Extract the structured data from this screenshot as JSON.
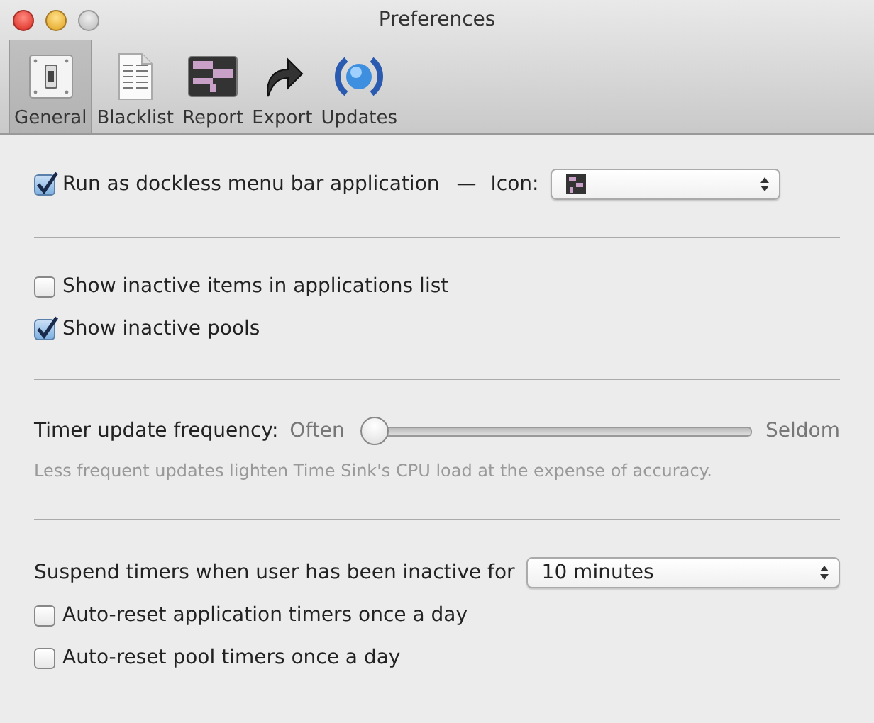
{
  "window": {
    "title": "Preferences"
  },
  "toolbar": [
    {
      "label": "General",
      "kind": "switch",
      "selected": true
    },
    {
      "label": "Blacklist",
      "kind": "document",
      "selected": false
    },
    {
      "label": "Report",
      "kind": "grid",
      "selected": false
    },
    {
      "label": "Export",
      "kind": "arrow",
      "selected": false
    },
    {
      "label": "Updates",
      "kind": "globe",
      "selected": false
    }
  ],
  "dock": {
    "label": "Run as dockless menu bar application",
    "checked": true,
    "separator": "—",
    "icon_label": "Icon:"
  },
  "list_options": [
    {
      "label": "Show inactive items in applications list",
      "checked": false
    },
    {
      "label": "Show inactive pools",
      "checked": true
    }
  ],
  "timer": {
    "label": "Timer update frequency:",
    "min_label": "Often",
    "max_label": "Seldom",
    "level": 0,
    "hint": "Less frequent updates lighten Time Sink's CPU load at the expense of accuracy."
  },
  "suspend": {
    "label": "Suspend timers when user has been inactive for",
    "value": "10 minutes"
  },
  "reset_options": [
    {
      "label": "Auto-reset application timers once a day",
      "checked": false
    },
    {
      "label": "Auto-reset pool timers once a day",
      "checked": false
    }
  ]
}
